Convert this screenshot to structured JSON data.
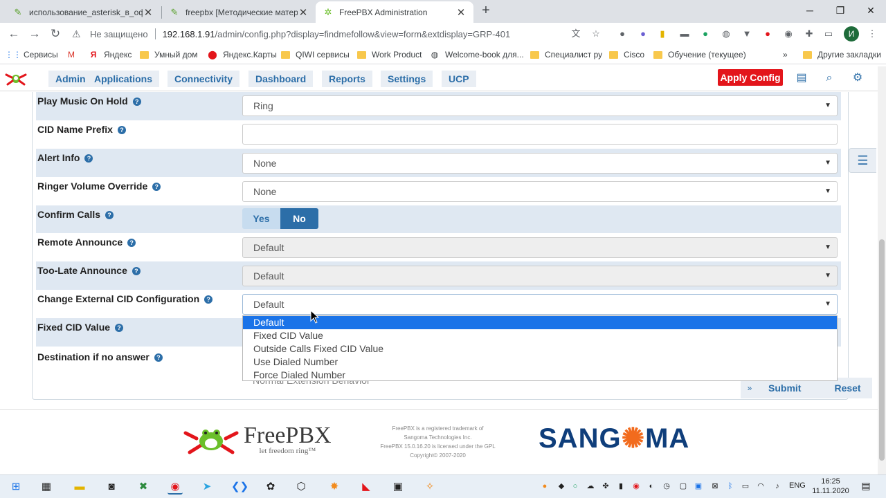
{
  "browser": {
    "tabs": [
      {
        "title": "использование_asterisk_в_офис",
        "icon": "doc-icon",
        "active": false
      },
      {
        "title": "freepbx [Методические матери",
        "icon": "doc-icon",
        "active": false
      },
      {
        "title": "FreePBX Administration",
        "icon": "freepbx-icon",
        "active": true
      }
    ],
    "security_label": "Не защищено",
    "url_host": "192.168.1.91",
    "url_path": "/admin/config.php?display=findmefollow&view=form&extdisplay=GRP-401",
    "profile_initial": "И",
    "bookmarks": [
      {
        "label": "Сервисы",
        "icon": "apps-icon"
      },
      {
        "label": "",
        "icon": "gmail-icon"
      },
      {
        "label": "Яндекс",
        "icon": "yandex-icon"
      },
      {
        "label": "Умный дом",
        "icon": "folder-icon"
      },
      {
        "label": "Яндекс.Карты",
        "icon": "maps-pin-icon"
      },
      {
        "label": "QIWI сервисы",
        "icon": "folder-icon"
      },
      {
        "label": "Work Product",
        "icon": "folder-icon"
      },
      {
        "label": "Welcome-book для...",
        "icon": "globe-icon"
      },
      {
        "label": "Специалист ру",
        "icon": "folder-icon"
      },
      {
        "label": "Cisco",
        "icon": "folder-icon"
      },
      {
        "label": "Обучение (текущее)",
        "icon": "folder-icon"
      }
    ],
    "bookmarks_overflow": "»",
    "other_bookmarks": "Другие закладки"
  },
  "nav": {
    "menu": [
      "Admin",
      "Applications",
      "Connectivity",
      "Dashboard",
      "Reports",
      "Settings",
      "UCP"
    ],
    "apply_config": "Apply Config"
  },
  "form": {
    "play_moh": {
      "label": "Play Music On Hold",
      "value": "Ring"
    },
    "cid_prefix": {
      "label": "CID Name Prefix",
      "value": ""
    },
    "alert_info": {
      "label": "Alert Info",
      "value": "None"
    },
    "ringer_volume": {
      "label": "Ringer Volume Override",
      "value": "None"
    },
    "confirm_calls": {
      "label": "Confirm Calls",
      "yes": "Yes",
      "no": "No",
      "selected": "No"
    },
    "remote_announce": {
      "label": "Remote Announce",
      "value": "Default"
    },
    "too_late_announce": {
      "label": "Too-Late Announce",
      "value": "Default"
    },
    "change_cid": {
      "label": "Change External CID Configuration",
      "value": "Default"
    },
    "fixed_cid": {
      "label": "Fixed CID Value"
    },
    "destination": {
      "label": "Destination if no answer",
      "value": "Normal Extension Behavior"
    },
    "cid_options": [
      "Default",
      "Fixed CID Value",
      "Outside Calls Fixed CID Value",
      "Use Dialed Number",
      "Force Dialed Number"
    ],
    "cid_selected_index": 0,
    "help_glyph": "?"
  },
  "actions": {
    "submit": "Submit",
    "reset": "Reset"
  },
  "footer": {
    "brand": "FreePBX",
    "tagline": "let freedom ring™",
    "legal_1": "FreePBX is a registered trademark of",
    "legal_2": "Sangoma Technologies Inc.",
    "legal_3": "FreePBX 15.0.16.20 is licensed under the GPL",
    "legal_4": "Copyright© 2007-2020",
    "vendor_1": "SANG",
    "vendor_2": "MA"
  },
  "taskbar": {
    "lang": "ENG",
    "time": "16:25",
    "date": "11.11.2020"
  },
  "colors": {
    "accent": "#2c6ea8",
    "apply": "#e3151b",
    "selected_option": "#1a73e8",
    "row_shade": "#dfe8f2"
  }
}
